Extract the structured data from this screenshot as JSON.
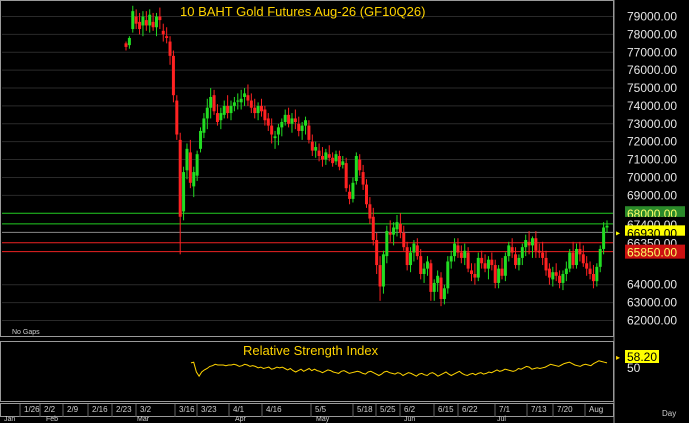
{
  "chart_data": {
    "type": "candlestick",
    "title": "10 BAHT Gold Futures Aug-26 (GF10Q26)",
    "note": "No Gaps",
    "period_label": "Day",
    "y_ticks": [
      "79000.00",
      "78000.00",
      "77000.00",
      "76000.00",
      "75000.00",
      "74000.00",
      "73000.00",
      "72000.00",
      "71000.00",
      "70000.00",
      "69000.00",
      "64000.00",
      "63000.00",
      "62000.00"
    ],
    "ylim": [
      61300,
      79700
    ],
    "levels": [
      {
        "label": "68000.00",
        "value": 68000,
        "line_color": "#22cc22",
        "box_bg": "#2a8a2a",
        "text_color": "#ffff66"
      },
      {
        "label": "67400.00",
        "value": 67400,
        "line_color": "#22cc22",
        "box_bg": "#000000",
        "text_color": "#e6e6e6"
      },
      {
        "label": "66930.00",
        "value": 66930,
        "line_color": "#888888",
        "box_bg": "#ffff00",
        "text_color": "#000000"
      },
      {
        "label": "66350.00",
        "value": 66350,
        "line_color": "#ee2222",
        "box_bg": "#000000",
        "text_color": "#e6e6e6"
      },
      {
        "label": "65850.00",
        "value": 65850,
        "line_color": "#ee2222",
        "box_bg": "#cc1111",
        "text_color": "#ffff66"
      }
    ],
    "x_labels": [
      "1/26",
      "2/2",
      "2/9",
      "2/16",
      "2/23",
      "3/2",
      "3/16",
      "3/23",
      "4/1",
      "4/16",
      "5/5",
      "5/18",
      "5/25",
      "6/2",
      "6/15",
      "6/22",
      "7/1",
      "7/13",
      "7/20",
      "Aug"
    ],
    "month_labels": [
      "Jan",
      "Feb",
      "Mar",
      "Apr",
      "May",
      "Jun",
      "Jul"
    ],
    "candles": [
      [
        77500,
        77600,
        77100,
        77300
      ],
      [
        77400,
        77900,
        77200,
        77800
      ],
      [
        78300,
        79600,
        78100,
        79300
      ],
      [
        79000,
        79400,
        78300,
        78600
      ],
      [
        78700,
        79200,
        78000,
        78300
      ],
      [
        78500,
        79300,
        77900,
        79000
      ],
      [
        78800,
        79300,
        78200,
        78500
      ],
      [
        78500,
        79400,
        78100,
        79100
      ],
      [
        78700,
        79200,
        78200,
        78400
      ],
      [
        78400,
        79200,
        77900,
        79000
      ],
      [
        79000,
        79500,
        78300,
        78800
      ],
      [
        78200,
        78600,
        77600,
        78000
      ],
      [
        77900,
        78400,
        77500,
        77800
      ],
      [
        77600,
        77900,
        76300,
        76800
      ],
      [
        76800,
        77100,
        74200,
        74600
      ],
      [
        74300,
        74600,
        72100,
        72400
      ],
      [
        72100,
        72500,
        65700,
        67800
      ],
      [
        68100,
        70600,
        67600,
        70300
      ],
      [
        70400,
        71900,
        69900,
        71600
      ],
      [
        71400,
        72100,
        69400,
        69700
      ],
      [
        69500,
        70600,
        68900,
        70300
      ],
      [
        70100,
        71500,
        69800,
        71300
      ],
      [
        71600,
        72800,
        71400,
        72600
      ],
      [
        72500,
        73600,
        72200,
        73300
      ],
      [
        73300,
        74400,
        72700,
        73900
      ],
      [
        73900,
        75000,
        73300,
        74500
      ],
      [
        74600,
        74900,
        73500,
        73700
      ],
      [
        73600,
        74100,
        72900,
        73100
      ],
      [
        73200,
        73900,
        72700,
        73600
      ],
      [
        73500,
        74300,
        73300,
        74000
      ],
      [
        74000,
        74600,
        73300,
        73600
      ],
      [
        73600,
        74300,
        73200,
        74000
      ],
      [
        74000,
        74500,
        73700,
        74200
      ],
      [
        74300,
        74700,
        73800,
        74300
      ],
      [
        74200,
        74900,
        73800,
        74400
      ],
      [
        74500,
        75000,
        74000,
        74700
      ],
      [
        74600,
        75200,
        74000,
        74300
      ],
      [
        74300,
        74700,
        73600,
        73900
      ],
      [
        73900,
        74400,
        73300,
        73600
      ],
      [
        73600,
        74200,
        73200,
        74000
      ],
      [
        74000,
        74400,
        73400,
        73700
      ],
      [
        73800,
        74000,
        72900,
        73200
      ],
      [
        73300,
        73600,
        72600,
        72900
      ],
      [
        72900,
        73300,
        71900,
        72400
      ],
      [
        72200,
        72600,
        71600,
        72300
      ],
      [
        72400,
        73000,
        71800,
        72800
      ],
      [
        72800,
        73300,
        72300,
        73100
      ],
      [
        73100,
        73800,
        72900,
        73500
      ],
      [
        73500,
        73900,
        72800,
        73000
      ],
      [
        73000,
        73600,
        72500,
        73300
      ],
      [
        73300,
        73800,
        72700,
        73100
      ],
      [
        73000,
        73400,
        72300,
        72600
      ],
      [
        72600,
        73100,
        72100,
        72900
      ],
      [
        72900,
        73400,
        72400,
        73200
      ],
      [
        72900,
        73200,
        71900,
        72100
      ],
      [
        72000,
        72400,
        71200,
        71500
      ],
      [
        71500,
        72000,
        71100,
        71700
      ],
      [
        71500,
        71900,
        70900,
        71200
      ],
      [
        71200,
        71700,
        70600,
        71000
      ],
      [
        71000,
        71600,
        70700,
        71400
      ],
      [
        71300,
        71800,
        70900,
        71100
      ],
      [
        71100,
        71400,
        70600,
        70800
      ],
      [
        70900,
        71500,
        70700,
        71300
      ],
      [
        71200,
        71500,
        70400,
        70600
      ],
      [
        70700,
        71200,
        70500,
        70900
      ],
      [
        70800,
        71100,
        69200,
        69400
      ],
      [
        69200,
        69600,
        68500,
        68800
      ],
      [
        68800,
        70000,
        68600,
        69700
      ],
      [
        69800,
        71400,
        69600,
        71200
      ],
      [
        71000,
        71300,
        70100,
        70400
      ],
      [
        70300,
        70700,
        69300,
        69600
      ],
      [
        69600,
        69900,
        68300,
        68500
      ],
      [
        68500,
        68900,
        67400,
        67700
      ],
      [
        67800,
        68300,
        66200,
        66500
      ],
      [
        66500,
        66900,
        64600,
        65100
      ],
      [
        65100,
        65600,
        63100,
        63900
      ],
      [
        63900,
        65900,
        63500,
        65700
      ],
      [
        65600,
        67300,
        65200,
        67000
      ],
      [
        66900,
        67600,
        66400,
        66800
      ],
      [
        66800,
        67500,
        66200,
        67200
      ],
      [
        67100,
        67900,
        66700,
        67500
      ],
      [
        67400,
        68000,
        66600,
        66900
      ],
      [
        66900,
        67300,
        65900,
        66100
      ],
      [
        66100,
        66400,
        64800,
        65100
      ],
      [
        65100,
        66100,
        64700,
        65800
      ],
      [
        65800,
        66500,
        65300,
        66300
      ],
      [
        66200,
        66600,
        65400,
        65600
      ],
      [
        65600,
        66000,
        64300,
        64600
      ],
      [
        64600,
        65200,
        64100,
        64900
      ],
      [
        64900,
        65600,
        64500,
        65300
      ],
      [
        65200,
        65400,
        63100,
        63600
      ],
      [
        63600,
        64300,
        63100,
        64100
      ],
      [
        64100,
        64800,
        63600,
        64500
      ],
      [
        64400,
        64700,
        62800,
        63200
      ],
      [
        63200,
        64000,
        62900,
        63800
      ],
      [
        63800,
        65600,
        63500,
        65300
      ],
      [
        65300,
        65900,
        64900,
        65600
      ],
      [
        65600,
        66600,
        65300,
        66300
      ],
      [
        66200,
        66600,
        65500,
        65800
      ],
      [
        65800,
        66200,
        65200,
        65500
      ],
      [
        65500,
        66300,
        65100,
        65900
      ],
      [
        65800,
        66100,
        64700,
        64900
      ],
      [
        64800,
        65200,
        64200,
        64600
      ],
      [
        64600,
        65200,
        64000,
        64400
      ],
      [
        64400,
        65800,
        64200,
        65500
      ],
      [
        65500,
        65900,
        64900,
        65200
      ],
      [
        65200,
        65700,
        64700,
        64900
      ],
      [
        64900,
        65600,
        64300,
        65400
      ],
      [
        65400,
        65800,
        64800,
        65100
      ],
      [
        65100,
        65400,
        63800,
        64100
      ],
      [
        64100,
        65100,
        63800,
        64900
      ],
      [
        64900,
        65500,
        64300,
        64500
      ],
      [
        64500,
        65800,
        64200,
        65600
      ],
      [
        65600,
        66400,
        65300,
        66200
      ],
      [
        66100,
        66600,
        65500,
        65800
      ],
      [
        65700,
        66100,
        64900,
        65100
      ],
      [
        65100,
        65700,
        64800,
        65500
      ],
      [
        65500,
        66300,
        65100,
        66100
      ],
      [
        66100,
        66800,
        65600,
        66500
      ],
      [
        66400,
        67000,
        65700,
        66200
      ],
      [
        66200,
        66700,
        65500,
        66600
      ],
      [
        66600,
        67000,
        65500,
        65900
      ],
      [
        65900,
        66300,
        65500,
        65800
      ],
      [
        65800,
        66400,
        65100,
        65500
      ],
      [
        65500,
        65900,
        64500,
        64800
      ],
      [
        64900,
        65200,
        64000,
        64400
      ],
      [
        64300,
        65000,
        63900,
        64700
      ],
      [
        64700,
        65200,
        64200,
        64500
      ],
      [
        64500,
        64800,
        63800,
        64100
      ],
      [
        64100,
        64800,
        63700,
        64600
      ],
      [
        64600,
        65300,
        64200,
        64900
      ],
      [
        64900,
        66000,
        64700,
        65800
      ],
      [
        65800,
        66400,
        64900,
        65100
      ],
      [
        65100,
        66300,
        64900,
        66000
      ],
      [
        66000,
        66400,
        65300,
        65700
      ],
      [
        65700,
        66200,
        65000,
        65200
      ],
      [
        65200,
        65600,
        64500,
        64900
      ],
      [
        64900,
        65300,
        64300,
        64600
      ],
      [
        64600,
        65100,
        63800,
        64200
      ],
      [
        64200,
        65200,
        63900,
        65000
      ],
      [
        65000,
        66200,
        64700,
        66000
      ],
      [
        66000,
        67500,
        65700,
        67200
      ],
      [
        67200,
        67600,
        66900,
        67300
      ]
    ],
    "rsi": {
      "title": "Relative Strength Index",
      "tick": "50",
      "last_label": "58.20",
      "ylim": [
        10,
        90
      ],
      "values": [
        63,
        64,
        50,
        44,
        50,
        53,
        55,
        58,
        59,
        61,
        60,
        60,
        60,
        59,
        60,
        60,
        61,
        60,
        58,
        59,
        61,
        60,
        58,
        59,
        58,
        56,
        57,
        55,
        56,
        57,
        54,
        55,
        57,
        56,
        57,
        55,
        53,
        55,
        52,
        50,
        52,
        54,
        51,
        53,
        55,
        52,
        54,
        52,
        51,
        49,
        51,
        53,
        52,
        50,
        49,
        48,
        51,
        52,
        50,
        48,
        49,
        50,
        51,
        50,
        48,
        47,
        50,
        51,
        49,
        47,
        45,
        47,
        50,
        51,
        49,
        48,
        47,
        49,
        48,
        45,
        47,
        49,
        48,
        46,
        44,
        47,
        48,
        46,
        45,
        48,
        49,
        47,
        44,
        46,
        48,
        50,
        47,
        45,
        47,
        49,
        51,
        48,
        46,
        45,
        47,
        48,
        46,
        48,
        49,
        47,
        48,
        50,
        49,
        51,
        53,
        51,
        52,
        54,
        53,
        52,
        51,
        52,
        55,
        54,
        56,
        58,
        57,
        54,
        55,
        56,
        55,
        56,
        57,
        59,
        61,
        60,
        59,
        58,
        60,
        62,
        63,
        64,
        62,
        60,
        59,
        58,
        60,
        61,
        60,
        59,
        62,
        64,
        66,
        65,
        64,
        63
      ]
    },
    "colors": {
      "up": "#22dd22",
      "down": "#ff2222",
      "rsi_line": "#ffd400",
      "grid": "#2a2a2a"
    }
  }
}
